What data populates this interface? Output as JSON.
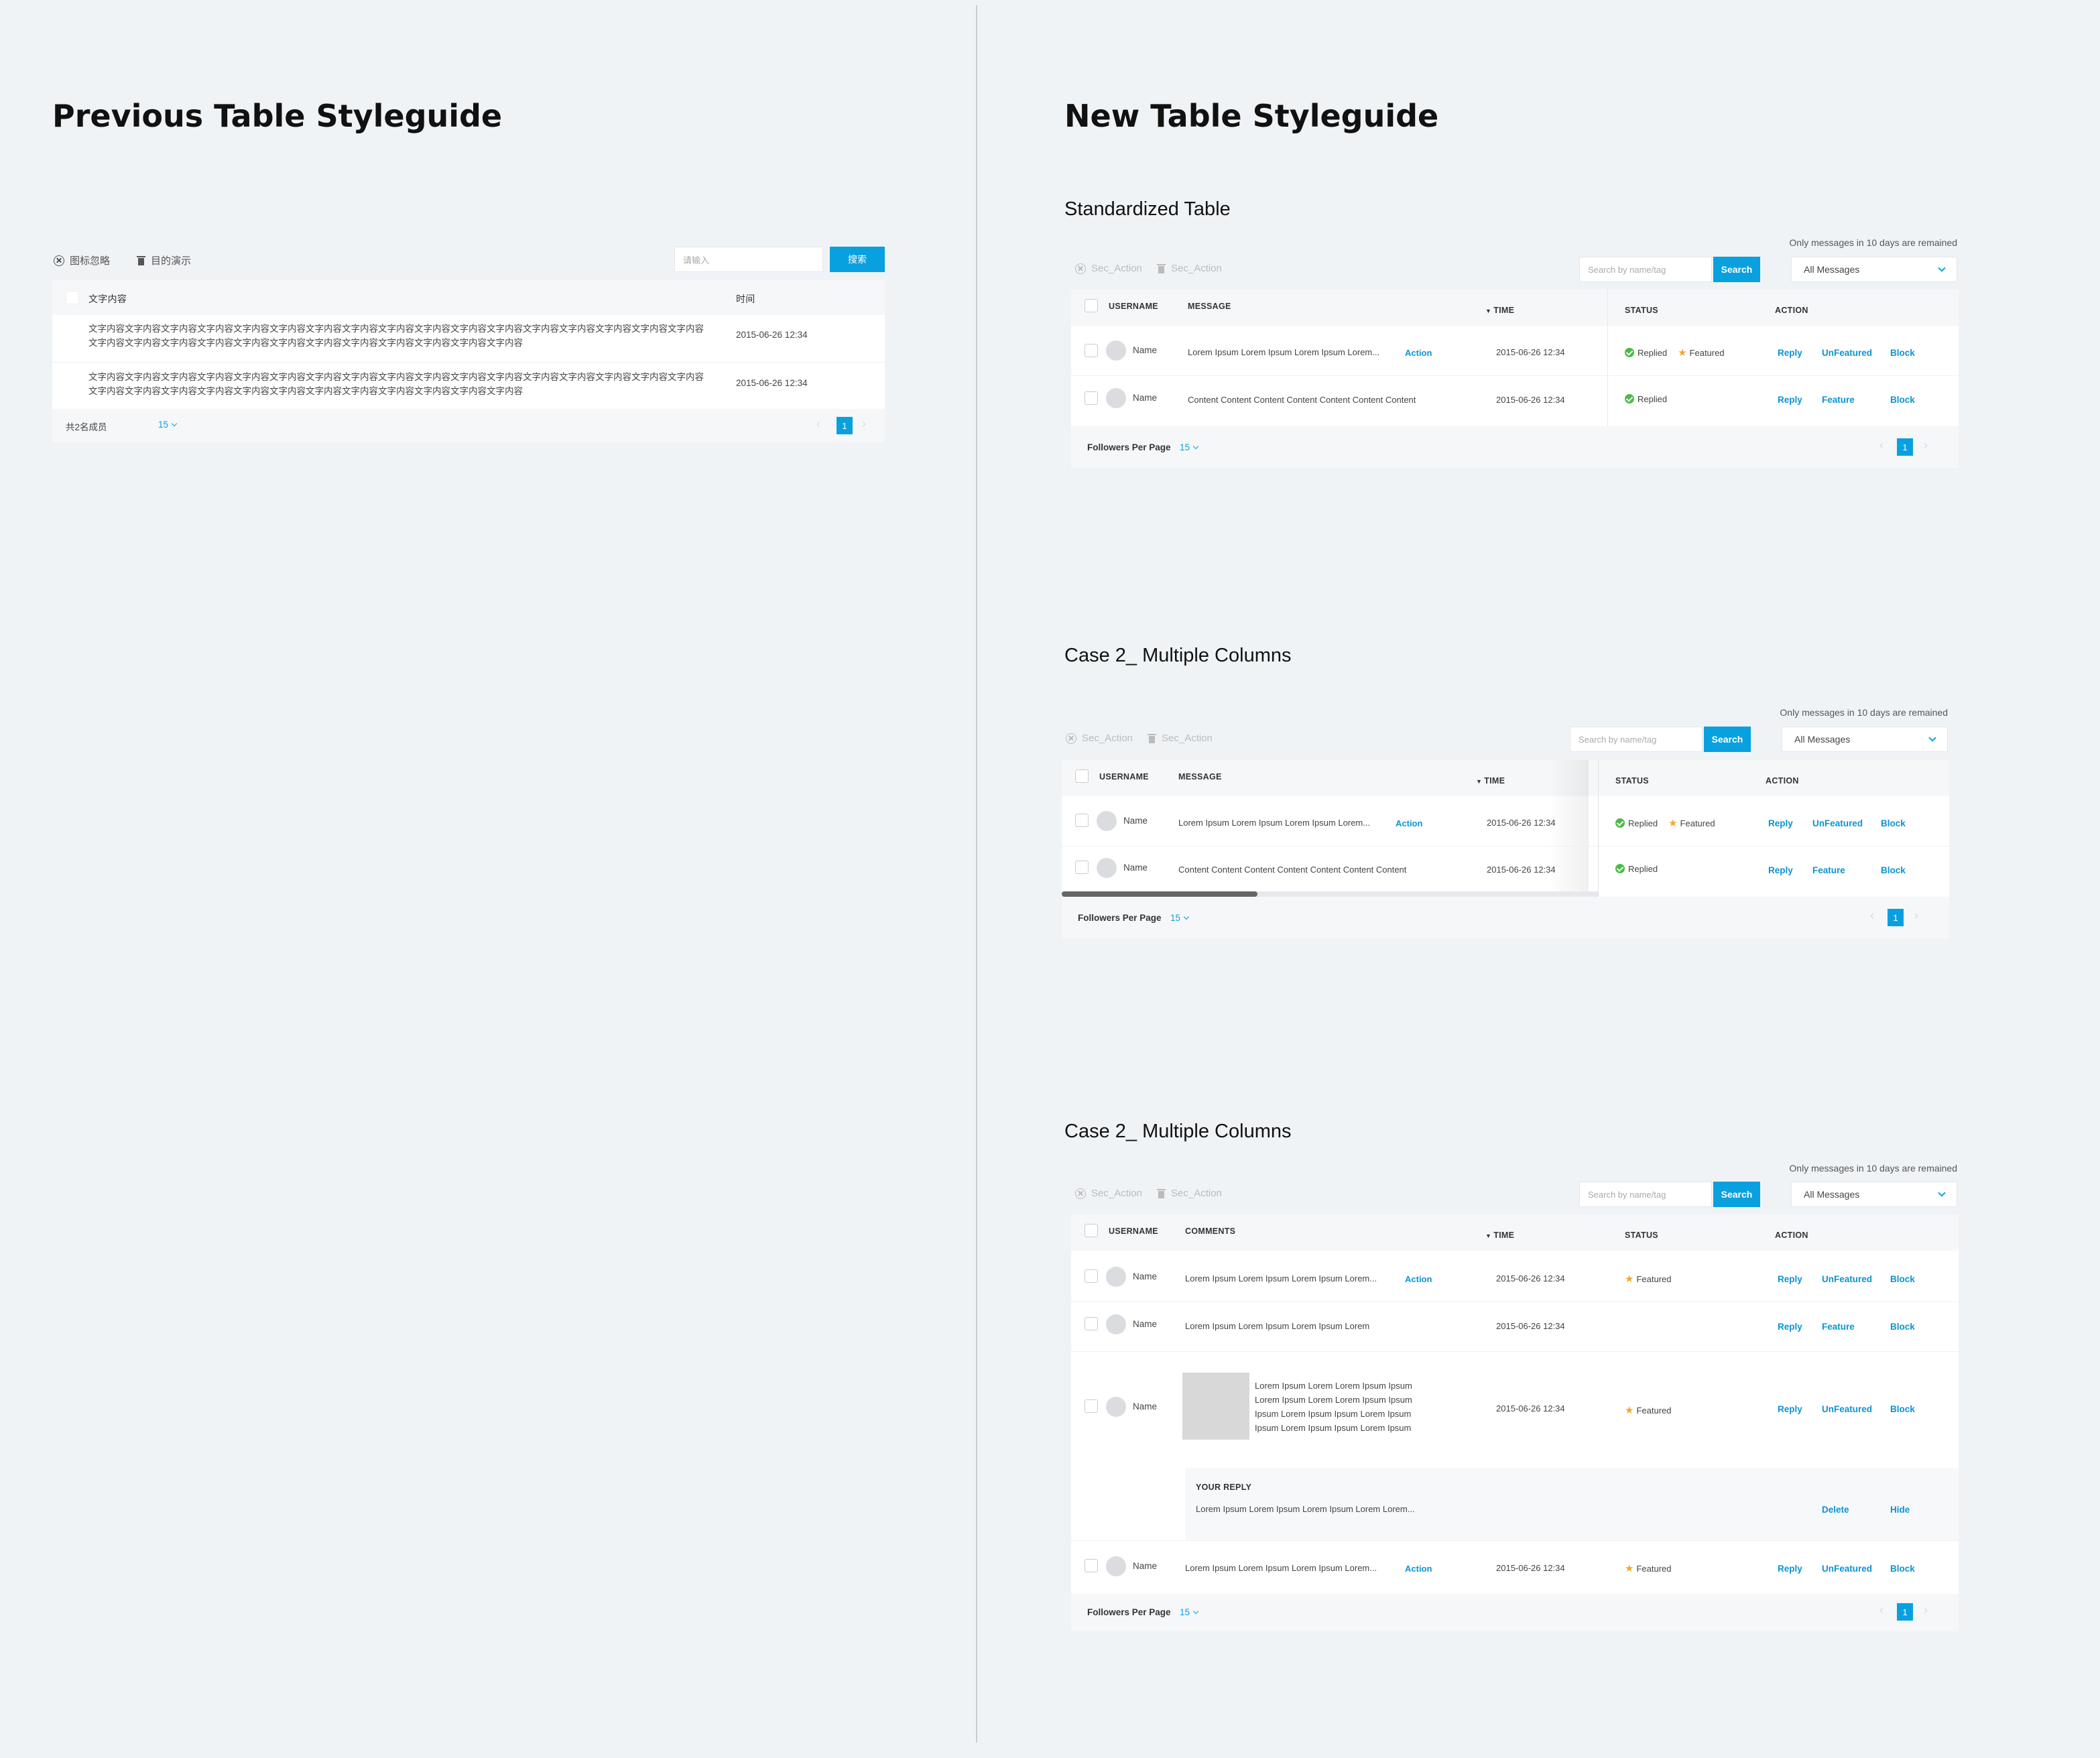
{
  "left": {
    "title": "Previous Table Styleguide",
    "toolbar": {
      "action1": "图标忽略",
      "action2": "目的演示",
      "search_placeholder": "请输入",
      "search_button": "搜索"
    },
    "headers": {
      "content": "文字内容",
      "time": "时间"
    },
    "rows": [
      {
        "text": "文字内容文字内容文字内容文字内容文字内容文字内容文字内容文字内容文字内容文字内容文字内容文字内容文字内容文字内容文字内容文字内容文字内容文字内容文字内容文字内容文字内容文字内容文字内容文字内容文字内容文字内容文字内容文字内容文字内容",
        "time": "2015-06-26 12:34"
      },
      {
        "text": "文字内容文字内容文字内容文字内容文字内容文字内容文字内容文字内容文字内容文字内容文字内容文字内容文字内容文字内容文字内容文字内容文字内容文字内容文字内容文字内容文字内容文字内容文字内容文字内容文字内容文字内容文字内容文字内容文字内容",
        "time": "2015-06-26 12:34"
      }
    ],
    "footer": {
      "total": "共2名成员",
      "per_page": "15",
      "page": "1"
    }
  },
  "right": {
    "title": "New Table Styleguide",
    "common": {
      "sec_action": "Sec_Action",
      "search_placeholder": "Search by name/tag",
      "search_button": "Search",
      "filter_value": "All Messages",
      "note": "Only messages in 10 days are remained",
      "h_username": "USERNAME",
      "h_message": "MESSAGE",
      "h_comments": "COMMENTS",
      "h_time": "TIME",
      "h_status": "STATUS",
      "h_action": "ACTION",
      "name": "Name",
      "time": "2015-06-26 12:34",
      "msg_long": "Lorem Ipsum Lorem Ipsum Lorem Ipsum Lorem...",
      "msg_content": "Content Content Content Content Content Content Content",
      "msg_short": "Lorem Ipsum Lorem Ipsum Lorem Ipsum Lorem",
      "inline_action": "Action",
      "replied": "Replied",
      "featured": "Featured",
      "reply": "Reply",
      "unfeatured": "UnFeatured",
      "feature": "Feature",
      "block": "Block",
      "per_page_label": "Followers Per Page",
      "per_page": "15",
      "page": "1",
      "your_reply": "YOUR REPLY",
      "reply_text": "Lorem Ipsum Lorem Ipsum Lorem Ipsum Lorem Lorem...",
      "delete": "Delete",
      "hide": "Hide",
      "thumb_text_1": "Lorem Ipsum Lorem Lorem Ipsum  Ipsum",
      "thumb_text_2": "Lorem Ipsum Lorem Lorem Ipsum Ipsum",
      "thumb_text_3": "Ipsum Lorem Ipsum Ipsum Lorem Ipsum",
      "thumb_text_4": "Ipsum Lorem Ipsum Ipsum Lorem Ipsum"
    },
    "section1": "Standardized Table",
    "section2": "Case 2_ Multiple Columns",
    "section3": "Case 2_ Multiple Columns",
    "colors": {
      "accent": "#09a0e0",
      "link": "#0b93d3",
      "success": "#4cbb47",
      "star": "#f5a623"
    }
  }
}
